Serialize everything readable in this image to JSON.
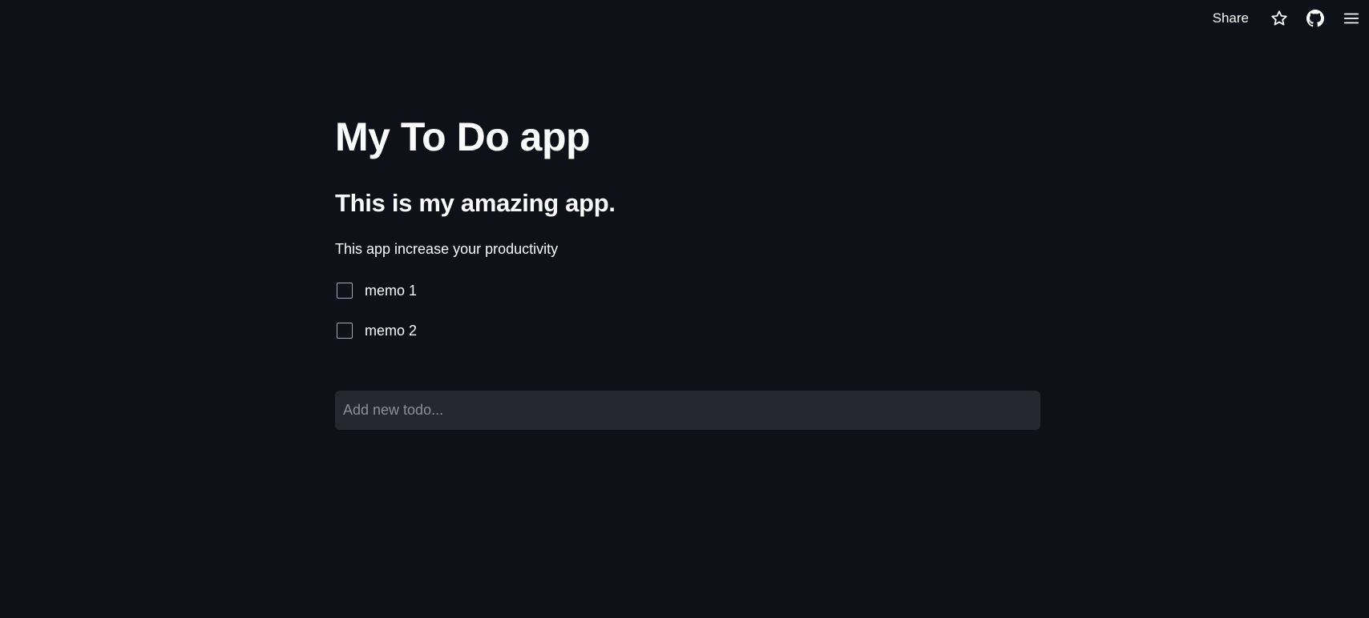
{
  "toolbar": {
    "share_label": "Share",
    "icons": [
      "star-icon",
      "github-icon",
      "hamburger-menu-icon"
    ]
  },
  "main": {
    "title": "My To Do app",
    "subtitle": "This is my amazing app.",
    "description": "This app increase your productivity",
    "todos": [
      {
        "label": "memo 1",
        "checked": false
      },
      {
        "label": "memo 2",
        "checked": false
      }
    ],
    "new_todo": {
      "value": "",
      "placeholder": "Add new todo..."
    }
  },
  "colors": {
    "background": "#0e1117",
    "text": "#fafafa",
    "input_background": "#262730",
    "placeholder": "#8d8f97",
    "checkbox_border": "#a3a8b8"
  }
}
